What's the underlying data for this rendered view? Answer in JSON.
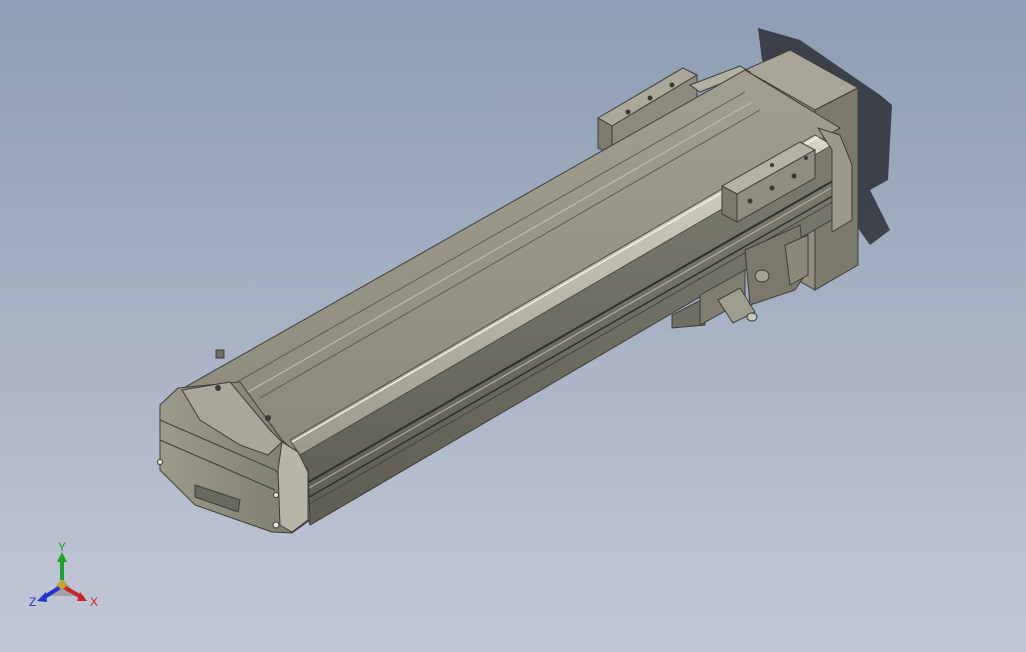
{
  "viewport": {
    "background_top": "#8e9db3",
    "background_bottom": "#c3c8d6",
    "model_color": "#8e8e80"
  },
  "triad": {
    "x_label": "X",
    "y_label": "Y",
    "z_label": "Z",
    "x_color": "#c8242a",
    "y_color": "#1f9e2c",
    "z_color": "#2236c9"
  }
}
